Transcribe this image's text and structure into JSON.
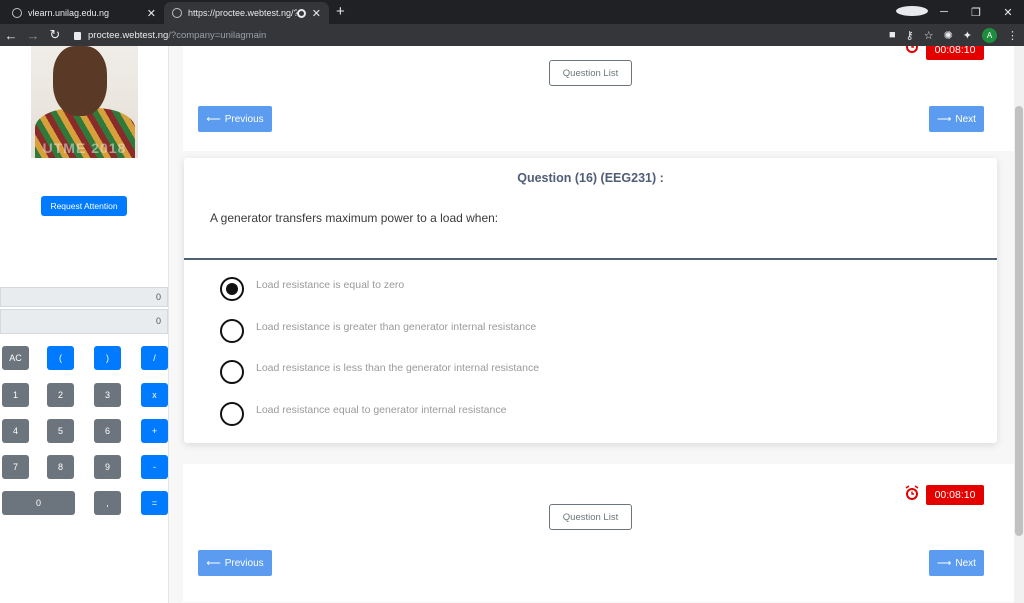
{
  "browser": {
    "tabs": [
      {
        "label": "vlearn.unilag.edu.ng",
        "active": false
      },
      {
        "label": "https://proctee.webtest.ng/?",
        "active": true
      }
    ],
    "url_host": "proctee.webtest.ng",
    "url_path": "/?company=unilagmain",
    "profile_initial": "A"
  },
  "sidebar": {
    "photo_watermark": "UTME 2018",
    "request_attention_label": "Request Attention",
    "calculator": {
      "display_top": "0",
      "display_bottom": "0",
      "keys": [
        "AC",
        "(",
        ")",
        "/",
        "1",
        "2",
        "3",
        "x",
        "4",
        "5",
        "6",
        "+",
        "7",
        "8",
        "9",
        "-",
        "0",
        ",",
        "="
      ]
    }
  },
  "nav": {
    "question_list_label": "Question List",
    "previous_label": "Previous",
    "next_label": "Next",
    "timer": "00:08:10",
    "colors": {
      "timer": "#e50000",
      "nav_button": "#5b9bf0",
      "primary": "#007bff"
    }
  },
  "question": {
    "title": "Question (16) (EEG231) :",
    "text": "A generator transfers maximum power to a load when:",
    "options": [
      {
        "label": "Load resistance is equal to zero",
        "selected": true
      },
      {
        "label": "Load resistance is greater than generator internal resistance",
        "selected": false
      },
      {
        "label": "Load resistance is less than the generator internal resistance",
        "selected": false
      },
      {
        "label": "Load resistance equal to generator internal resistance",
        "selected": false
      }
    ]
  }
}
